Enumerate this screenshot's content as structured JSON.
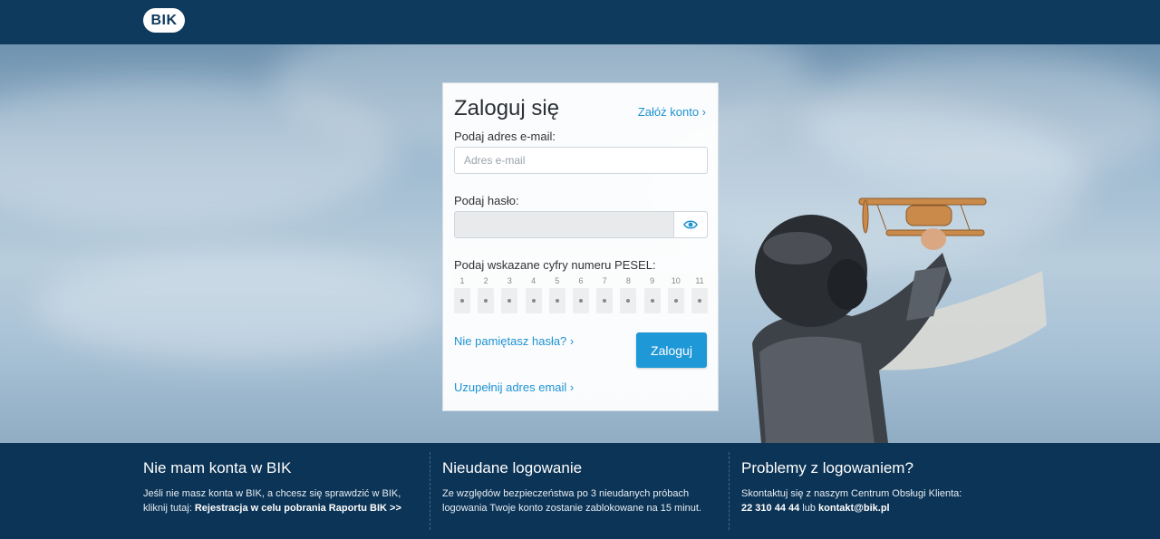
{
  "header": {
    "logo_text": "BIK"
  },
  "login": {
    "title": "Zaloguj się",
    "create_account": "Załóż konto ›",
    "email_label": "Podaj adres e-mail:",
    "email_placeholder": "Adres e-mail",
    "password_label": "Podaj hasło:",
    "pesel_label": "Podaj wskazane cyfry numeru PESEL:",
    "pesel_positions": [
      "1",
      "2",
      "3",
      "4",
      "5",
      "6",
      "7",
      "8",
      "9",
      "10",
      "11"
    ],
    "forgot": "Nie pamiętasz hasła? ›",
    "submit": "Zaloguj",
    "complete_email": "Uzupełnij adres email ›"
  },
  "footer": {
    "col1": {
      "title": "Nie mam konta w BIK",
      "text": "Jeśli nie masz konta w BIK, a chcesz się sprawdzić w BIK, kliknij tutaj: ",
      "link": "Rejestracja w celu pobrania Raportu BIK >>"
    },
    "col2": {
      "title": "Nieudane logowanie",
      "text": "Ze względów bezpieczeństwa po 3 nieudanych próbach logowania Twoje konto zostanie zablokowane na 15 minut."
    },
    "col3": {
      "title": "Problemy z logowaniem?",
      "text": "Skontaktuj się z naszym Centrum Obsługi Klienta:",
      "phone": "22 310 44 44",
      "or": " lub ",
      "email": "kontakt@bik.pl"
    }
  },
  "colors": {
    "brand": "#0e3a5d",
    "accent": "#1f98d8",
    "link": "#1e93d2"
  },
  "icons": [
    "eye-icon"
  ]
}
